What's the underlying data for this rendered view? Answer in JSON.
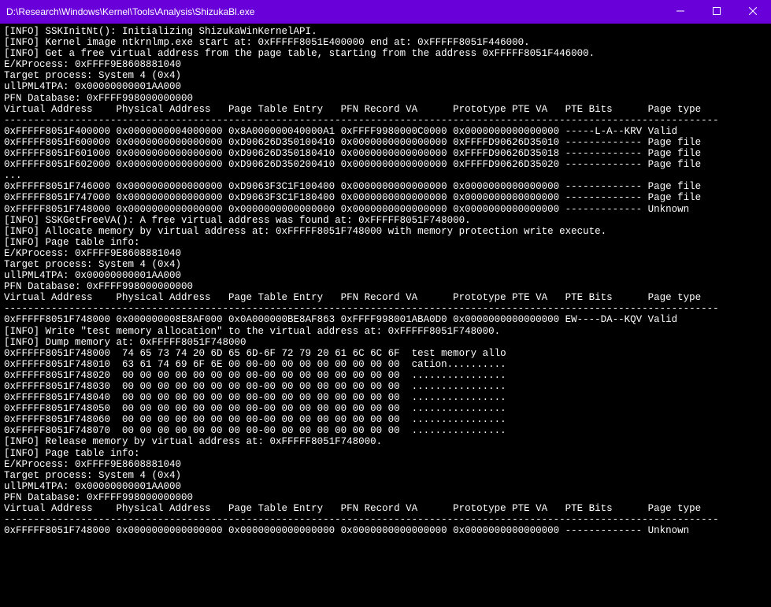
{
  "window": {
    "title": "D:\\Research\\Windows\\Kernel\\Tools\\Analysis\\ShizukaBl.exe"
  },
  "lines": [
    "[INFO] SSKInitNt(): Initializing ShizukaWinKernelAPI.",
    "[INFO] Kernel image ntkrnlmp.exe start at: 0xFFFFF8051E400000 end at: 0xFFFFF8051F446000.",
    "[INFO] Get a free virtual address from the page table, starting from the address 0xFFFFF8051F446000.",
    "E/KProcess: 0xFFFF9E8608881040",
    "Target process: System 4 (0x4)",
    "ullPML4TPA: 0x00000000001AA000",
    "PFN Database: 0xFFFF998000000000",
    "Virtual Address    Physical Address   Page Table Entry   PFN Record VA      Prototype PTE VA   PTE Bits      Page type",
    "-------------------------------------------------------------------------------------------------------------------------",
    "0xFFFFF8051F400000 0x0000000004000000 0x8A000000040000A1 0xFFFF9980000C0000 0x0000000000000000 -----L-A--KRV Valid",
    "0xFFFFF8051F600000 0x0000000000000000 0xD90626D350100410 0x0000000000000000 0xFFFFD90626D35010 ------------- Page file",
    "0xFFFFF8051F601000 0x0000000000000000 0xD90626D350180410 0x0000000000000000 0xFFFFD90626D35018 ------------- Page file",
    "0xFFFFF8051F602000 0x0000000000000000 0xD90626D350200410 0x0000000000000000 0xFFFFD90626D35020 ------------- Page file",
    "...",
    "0xFFFFF8051F746000 0x0000000000000000 0xD9063F3C1F100400 0x0000000000000000 0x0000000000000000 ------------- Page file",
    "0xFFFFF8051F747000 0x0000000000000000 0xD9063F3C1F180400 0x0000000000000000 0x0000000000000000 ------------- Page file",
    "0xFFFFF8051F748000 0x0000000000000000 0x0000000000000000 0x0000000000000000 0x0000000000000000 ------------- Unknown",
    "[INFO] SSKGetFreeVA(): A free virtual address was found at: 0xFFFFF8051F748000.",
    "[INFO] Allocate memory by virtual address at: 0xFFFFF8051F748000 with memory protection write execute.",
    "[INFO] Page table info:",
    "E/KProcess: 0xFFFF9E8608881040",
    "Target process: System 4 (0x4)",
    "ullPML4TPA: 0x00000000001AA000",
    "PFN Database: 0xFFFF998000000000",
    "Virtual Address    Physical Address   Page Table Entry   PFN Record VA      Prototype PTE VA   PTE Bits      Page type",
    "-------------------------------------------------------------------------------------------------------------------------",
    "0xFFFFF8051F748000 0x000000008E8AF000 0x0A000000BE8AF863 0xFFFF998001ABA0D0 0x0000000000000000 EW----DA--KQV Valid",
    "[INFO] Write \"test memory allocation\" to the virtual address at: 0xFFFFF8051F748000.",
    "[INFO] Dump memory at: 0xFFFFF8051F748000",
    "0xFFFFF8051F748000  74 65 73 74 20 6D 65 6D-6F 72 79 20 61 6C 6C 6F  test memory allo",
    "0xFFFFF8051F748010  63 61 74 69 6F 6E 00 00-00 00 00 00 00 00 00 00  cation..........",
    "0xFFFFF8051F748020  00 00 00 00 00 00 00 00-00 00 00 00 00 00 00 00  ................",
    "0xFFFFF8051F748030  00 00 00 00 00 00 00 00-00 00 00 00 00 00 00 00  ................",
    "0xFFFFF8051F748040  00 00 00 00 00 00 00 00-00 00 00 00 00 00 00 00  ................",
    "0xFFFFF8051F748050  00 00 00 00 00 00 00 00-00 00 00 00 00 00 00 00  ................",
    "0xFFFFF8051F748060  00 00 00 00 00 00 00 00-00 00 00 00 00 00 00 00  ................",
    "0xFFFFF8051F748070  00 00 00 00 00 00 00 00-00 00 00 00 00 00 00 00  ................",
    "[INFO] Release memory by virtual address at: 0xFFFFF8051F748000.",
    "[INFO] Page table info:",
    "E/KProcess: 0xFFFF9E8608881040",
    "Target process: System 4 (0x4)",
    "ullPML4TPA: 0x00000000001AA000",
    "PFN Database: 0xFFFF998000000000",
    "Virtual Address    Physical Address   Page Table Entry   PFN Record VA      Prototype PTE VA   PTE Bits      Page type",
    "-------------------------------------------------------------------------------------------------------------------------",
    "0xFFFFF8051F748000 0x0000000000000000 0x0000000000000000 0x0000000000000000 0x0000000000000000 ------------- Unknown"
  ]
}
